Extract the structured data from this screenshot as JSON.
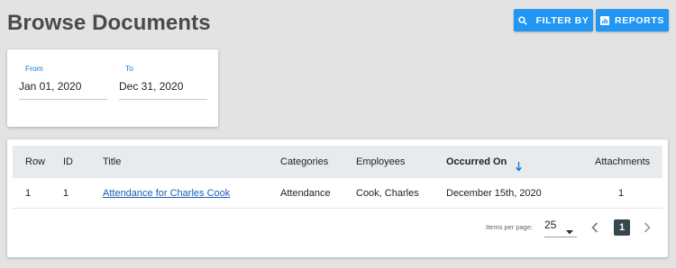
{
  "page": {
    "title": "Browse Documents"
  },
  "toolbar": {
    "filter_label": "FILTER BY",
    "reports_label": "REPORTS",
    "filter_icon": "search-icon",
    "reports_icon": "bar-chart-icon",
    "accent_color": "#2196f3"
  },
  "date_range": {
    "from_label": "From",
    "from_value": "Jan 01, 2020",
    "to_label": "To",
    "to_value": "Dec 31, 2020"
  },
  "table": {
    "headers": {
      "row": "Row",
      "id": "ID",
      "title": "Title",
      "categories": "Categories",
      "employees": "Employees",
      "occurred_on": "Occurred On",
      "attachments": "Attachments"
    },
    "sorted_column": "occurred_on",
    "sort_direction": "descending",
    "rows": [
      {
        "row": "1",
        "id": "1",
        "title": "Attendance for Charles Cook",
        "categories": "Attendance",
        "employees": "Cook, Charles",
        "occurred_on": "December 15th, 2020",
        "attachments": "1"
      }
    ]
  },
  "paginator": {
    "items_per_page_label": "Items per page:",
    "items_per_page_value": "25",
    "current_page": "1"
  }
}
